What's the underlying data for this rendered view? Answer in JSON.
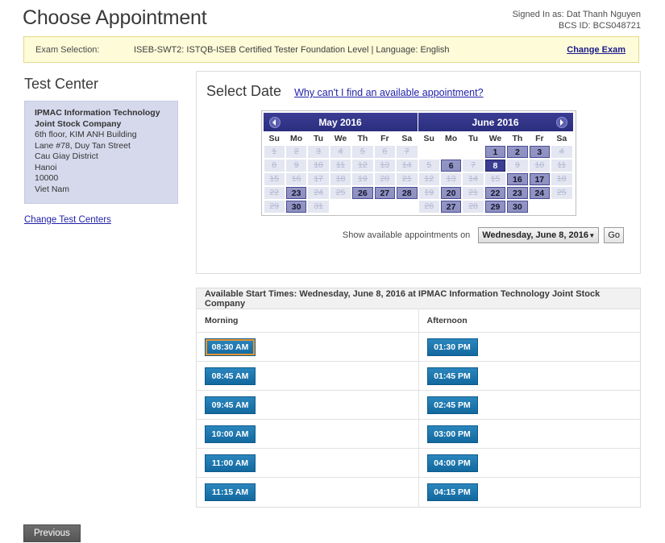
{
  "header": {
    "title": "Choose Appointment",
    "signed_in_as": "Signed In as: Dat Thanh Nguyen",
    "bcs_id": "BCS ID: BCS048721"
  },
  "exam_bar": {
    "label": "Exam Selection:",
    "value": "ISEB-SWT2: ISTQB-ISEB Certified Tester Foundation Level | Language: English",
    "change_link": "Change Exam"
  },
  "test_center": {
    "heading": "Test Center",
    "lines": [
      "IPMAC Information Technology",
      "Joint Stock Company",
      "6th floor, KIM ANH Building",
      "Lane #78, Duy Tan Street",
      "Cau Giay District",
      "Hanoi",
      "10000",
      "Viet Nam"
    ],
    "change_link": "Change Test Centers"
  },
  "select_date": {
    "heading": "Select Date",
    "help_link": "Why can't I find an available appointment?",
    "prev_icon": "chevron-left-icon",
    "next_icon": "chevron-right-icon",
    "weekday_headers": [
      "Su",
      "Mo",
      "Tu",
      "We",
      "Th",
      "Fr",
      "Sa"
    ],
    "months": [
      {
        "name": "May 2016",
        "weeks": [
          [
            {
              "d": "1",
              "s": "off"
            },
            {
              "d": "2",
              "s": "off"
            },
            {
              "d": "3",
              "s": "off"
            },
            {
              "d": "4",
              "s": "off"
            },
            {
              "d": "5",
              "s": "off"
            },
            {
              "d": "6",
              "s": "off"
            },
            {
              "d": "7",
              "s": "off"
            }
          ],
          [
            {
              "d": "8",
              "s": "off"
            },
            {
              "d": "9",
              "s": "off"
            },
            {
              "d": "10",
              "s": "off"
            },
            {
              "d": "11",
              "s": "off"
            },
            {
              "d": "12",
              "s": "off"
            },
            {
              "d": "13",
              "s": "off"
            },
            {
              "d": "14",
              "s": "off"
            }
          ],
          [
            {
              "d": "15",
              "s": "off"
            },
            {
              "d": "16",
              "s": "off"
            },
            {
              "d": "17",
              "s": "off"
            },
            {
              "d": "18",
              "s": "off"
            },
            {
              "d": "19",
              "s": "off"
            },
            {
              "d": "20",
              "s": "off"
            },
            {
              "d": "21",
              "s": "off"
            }
          ],
          [
            {
              "d": "22",
              "s": "off"
            },
            {
              "d": "23",
              "s": "avail"
            },
            {
              "d": "24",
              "s": "off"
            },
            {
              "d": "25",
              "s": "off"
            },
            {
              "d": "26",
              "s": "avail"
            },
            {
              "d": "27",
              "s": "avail"
            },
            {
              "d": "28",
              "s": "avail"
            }
          ],
          [
            {
              "d": "29",
              "s": "off"
            },
            {
              "d": "30",
              "s": "avail"
            },
            {
              "d": "31",
              "s": "off"
            },
            {
              "d": "",
              "s": "blank"
            },
            {
              "d": "",
              "s": "blank"
            },
            {
              "d": "",
              "s": "blank"
            },
            {
              "d": "",
              "s": "blank"
            }
          ]
        ]
      },
      {
        "name": "June 2016",
        "weeks": [
          [
            {
              "d": "",
              "s": "blank"
            },
            {
              "d": "",
              "s": "blank"
            },
            {
              "d": "",
              "s": "blank"
            },
            {
              "d": "1",
              "s": "avail"
            },
            {
              "d": "2",
              "s": "avail"
            },
            {
              "d": "3",
              "s": "avail"
            },
            {
              "d": "4",
              "s": "off"
            }
          ],
          [
            {
              "d": "5",
              "s": "off"
            },
            {
              "d": "6",
              "s": "avail"
            },
            {
              "d": "7",
              "s": "off"
            },
            {
              "d": "8",
              "s": "sel"
            },
            {
              "d": "9",
              "s": "off"
            },
            {
              "d": "10",
              "s": "off"
            },
            {
              "d": "11",
              "s": "off"
            }
          ],
          [
            {
              "d": "12",
              "s": "off"
            },
            {
              "d": "13",
              "s": "off"
            },
            {
              "d": "14",
              "s": "off"
            },
            {
              "d": "15",
              "s": "off"
            },
            {
              "d": "16",
              "s": "avail"
            },
            {
              "d": "17",
              "s": "avail"
            },
            {
              "d": "18",
              "s": "off"
            }
          ],
          [
            {
              "d": "19",
              "s": "off"
            },
            {
              "d": "20",
              "s": "avail"
            },
            {
              "d": "21",
              "s": "off"
            },
            {
              "d": "22",
              "s": "avail"
            },
            {
              "d": "23",
              "s": "avail"
            },
            {
              "d": "24",
              "s": "avail"
            },
            {
              "d": "25",
              "s": "off"
            }
          ],
          [
            {
              "d": "26",
              "s": "off"
            },
            {
              "d": "27",
              "s": "avail"
            },
            {
              "d": "28",
              "s": "off"
            },
            {
              "d": "29",
              "s": "avail"
            },
            {
              "d": "30",
              "s": "avail"
            },
            {
              "d": "",
              "s": "blank"
            },
            {
              "d": "",
              "s": "blank"
            }
          ]
        ]
      }
    ],
    "show_label": "Show available appointments on",
    "selected_date": "Wednesday, June 8, 2016",
    "caret_icon": "chevron-down-icon",
    "go_label": "Go"
  },
  "times": {
    "title": "Available Start Times: Wednesday, June 8, 2016 at IPMAC Information Technology Joint Stock Company",
    "columns": [
      "Morning",
      "Afternoon"
    ],
    "rows": [
      {
        "morning": "08:30 AM",
        "afternoon": "01:30 PM",
        "morning_focused": true
      },
      {
        "morning": "08:45 AM",
        "afternoon": "01:45 PM",
        "morning_focused": false
      },
      {
        "morning": "09:45 AM",
        "afternoon": "02:45 PM",
        "morning_focused": false
      },
      {
        "morning": "10:00 AM",
        "afternoon": "03:00 PM",
        "morning_focused": false
      },
      {
        "morning": "11:00 AM",
        "afternoon": "04:00 PM",
        "morning_focused": false
      },
      {
        "morning": "11:15 AM",
        "afternoon": "04:15 PM",
        "morning_focused": false
      }
    ]
  },
  "footer": {
    "previous_label": "Previous"
  },
  "colors": {
    "accent_blue": "#12699f",
    "calendar_header": "#2b2d7e",
    "selected_day": "#3a3d92",
    "available_day": "#9396c4",
    "exam_bar_bg": "#fdfbd8",
    "focus_outline": "#e8962f"
  }
}
